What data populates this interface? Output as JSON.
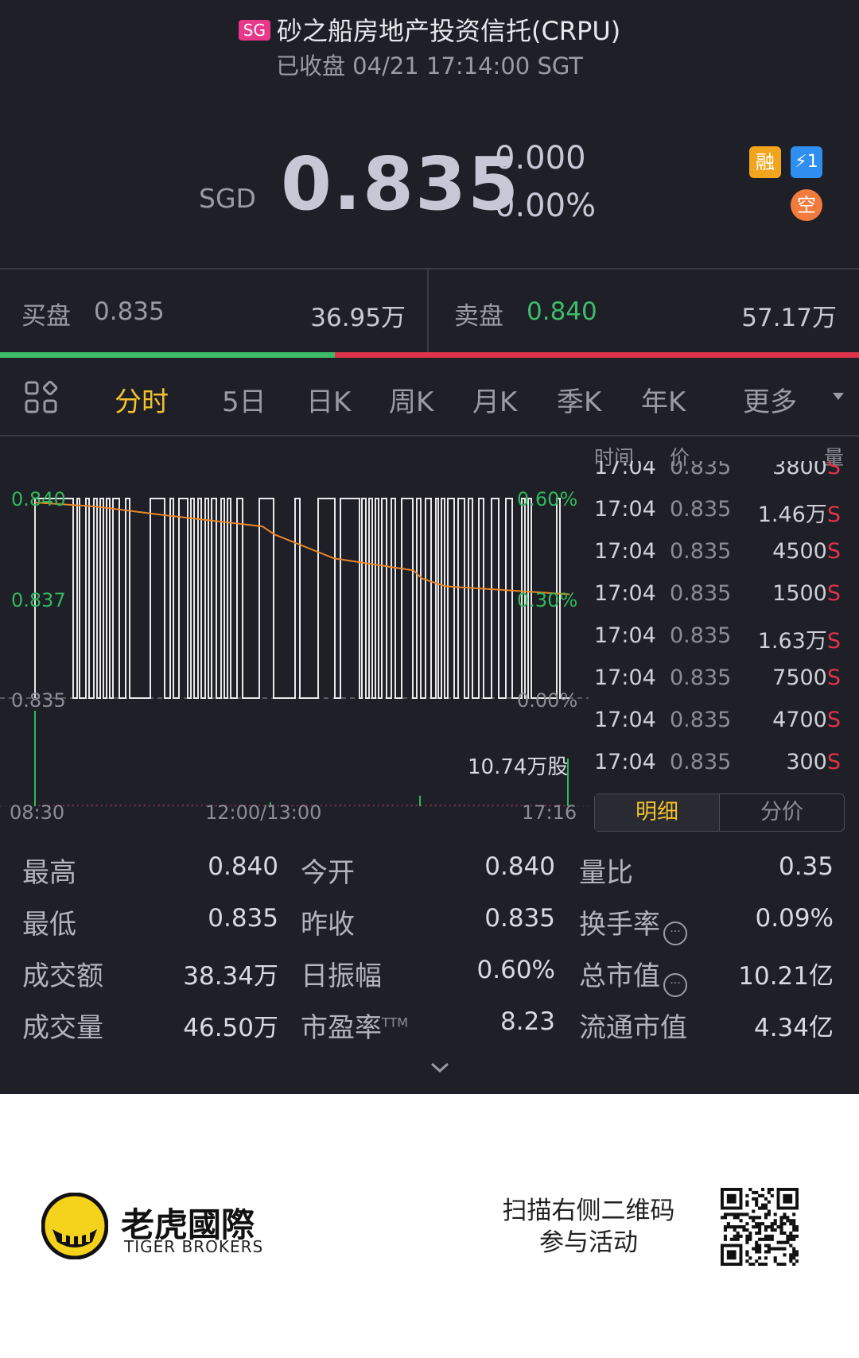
{
  "header": {
    "market_badge": "SG",
    "title": "砂之船房地产投资信托(CRPU)",
    "status": "已收盘 04/21 17:14:00 SGT"
  },
  "quote": {
    "currency": "SGD",
    "price": "0.835",
    "change": "0.000",
    "change_pct": "0.00%",
    "badges": [
      "融",
      "⚡1",
      "空"
    ]
  },
  "order_book": {
    "bid_label": "买盘",
    "bid_price": "0.835",
    "bid_volume": "36.95万",
    "ask_label": "卖盘",
    "ask_price": "0.840",
    "ask_volume": "57.17万",
    "bid_ratio": 0.39,
    "colors": {
      "bid": "#3dbd6a",
      "ask": "#e0344c"
    }
  },
  "tabs": [
    "分时",
    "5日",
    "日K",
    "周K",
    "月K",
    "季K",
    "年K",
    "更多"
  ],
  "active_tab": "分时",
  "chart_data": {
    "type": "line",
    "y_left_ticks": [
      "0.840",
      "0.837",
      "0.835"
    ],
    "y_right_ticks": [
      "0.60%",
      "0.30%",
      "0.00%"
    ],
    "x_ticks": [
      "08:30",
      "12:00/13:00",
      "17:16"
    ],
    "volume_label": "10.74万股",
    "ylim": [
      0.835,
      0.84
    ],
    "avg_price_series": [
      0.8399,
      0.8398,
      0.8396,
      0.8393,
      0.8391,
      0.8385,
      0.8382,
      0.838,
      0.8378,
      0.8377,
      0.8376
    ],
    "colors": {
      "price": "#e8e8e8",
      "avg": "#e8872a",
      "volume": "#2fb85c"
    }
  },
  "trades": {
    "headers": {
      "time": "时间",
      "price": "价",
      "volume": "量"
    },
    "rows": [
      {
        "time": "17:04",
        "price": "0.835",
        "vol": "3800",
        "side": "S"
      },
      {
        "time": "17:04",
        "price": "0.835",
        "vol": "1.46万",
        "side": "S"
      },
      {
        "time": "17:04",
        "price": "0.835",
        "vol": "4500",
        "side": "S"
      },
      {
        "time": "17:04",
        "price": "0.835",
        "vol": "1500",
        "side": "S"
      },
      {
        "time": "17:04",
        "price": "0.835",
        "vol": "1.63万",
        "side": "S"
      },
      {
        "time": "17:04",
        "price": "0.835",
        "vol": "7500",
        "side": "S"
      },
      {
        "time": "17:04",
        "price": "0.835",
        "vol": "4700",
        "side": "S"
      },
      {
        "time": "17:04",
        "price": "0.835",
        "vol": "300",
        "side": "S"
      }
    ],
    "toggle": {
      "detail": "明细",
      "by_price": "分价"
    }
  },
  "stats": [
    [
      {
        "label": "最高",
        "value": "0.840"
      },
      {
        "label": "今开",
        "value": "0.840"
      },
      {
        "label": "量比",
        "value": "0.35"
      }
    ],
    [
      {
        "label": "最低",
        "value": "0.835"
      },
      {
        "label": "昨收",
        "value": "0.835"
      },
      {
        "label": "换手率",
        "value": "0.09%",
        "info": true
      }
    ],
    [
      {
        "label": "成交额",
        "value": "38.34万"
      },
      {
        "label": "日振幅",
        "value": "0.60%"
      },
      {
        "label": "总市值",
        "value": "10.21亿",
        "info": true
      }
    ],
    [
      {
        "label": "成交量",
        "value": "46.50万"
      },
      {
        "label": "市盈率",
        "sup": "TTM",
        "value": "8.23"
      },
      {
        "label": "流通市值",
        "value": "4.34亿"
      }
    ]
  ],
  "footer": {
    "brand_cn": "老虎國際",
    "brand_en": "TIGER BROKERS",
    "cta_line1": "扫描右侧二维码",
    "cta_line2": "参与活动"
  }
}
